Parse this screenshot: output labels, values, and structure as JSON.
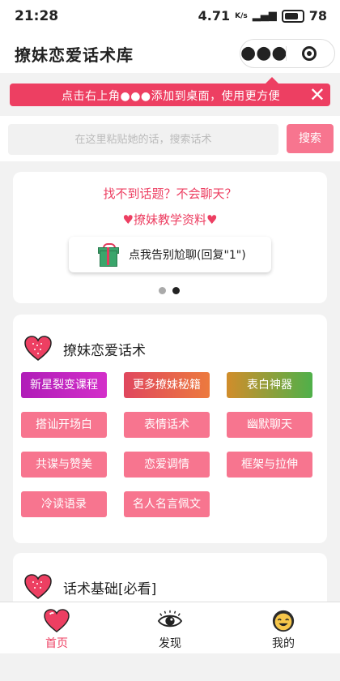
{
  "status": {
    "time": "21:28",
    "speed": "4.71",
    "speed_unit": "K/s",
    "battery": "78"
  },
  "nav": {
    "title": "撩妹恋爱话术库",
    "more_icon": "●●●"
  },
  "tip": {
    "text": "点击右上角●●●添加到桌面，使用更方便",
    "close": "✕"
  },
  "search": {
    "placeholder": "在这里粘贴她的话，搜索话术",
    "value": "",
    "button": "搜索"
  },
  "banner": {
    "line1": "找不到话题？不会聊天？",
    "line2": "♥撩妹教学资料♥",
    "button": "点我告别尬聊(回复\"1\")"
  },
  "section1": {
    "title": "撩妹恋爱话术",
    "tags": [
      "新星裂变课程",
      "更多撩妹秘籍",
      "表白神器",
      "搭讪开场白",
      "表情话术",
      "幽默聊天",
      "共谍与赞美",
      "恋爱调情",
      "框架与拉伸",
      "冷读语录",
      "名人名言佩文"
    ]
  },
  "section2": {
    "title": "话术基础[必看]"
  },
  "tabs": [
    {
      "label": "首页",
      "icon": "heart-icon",
      "active": true
    },
    {
      "label": "发现",
      "icon": "eye-icon",
      "active": false
    },
    {
      "label": "我的",
      "icon": "face-icon",
      "active": false
    }
  ],
  "colors": {
    "accent": "#ed3f62",
    "tag_pink": "#f7758f"
  }
}
